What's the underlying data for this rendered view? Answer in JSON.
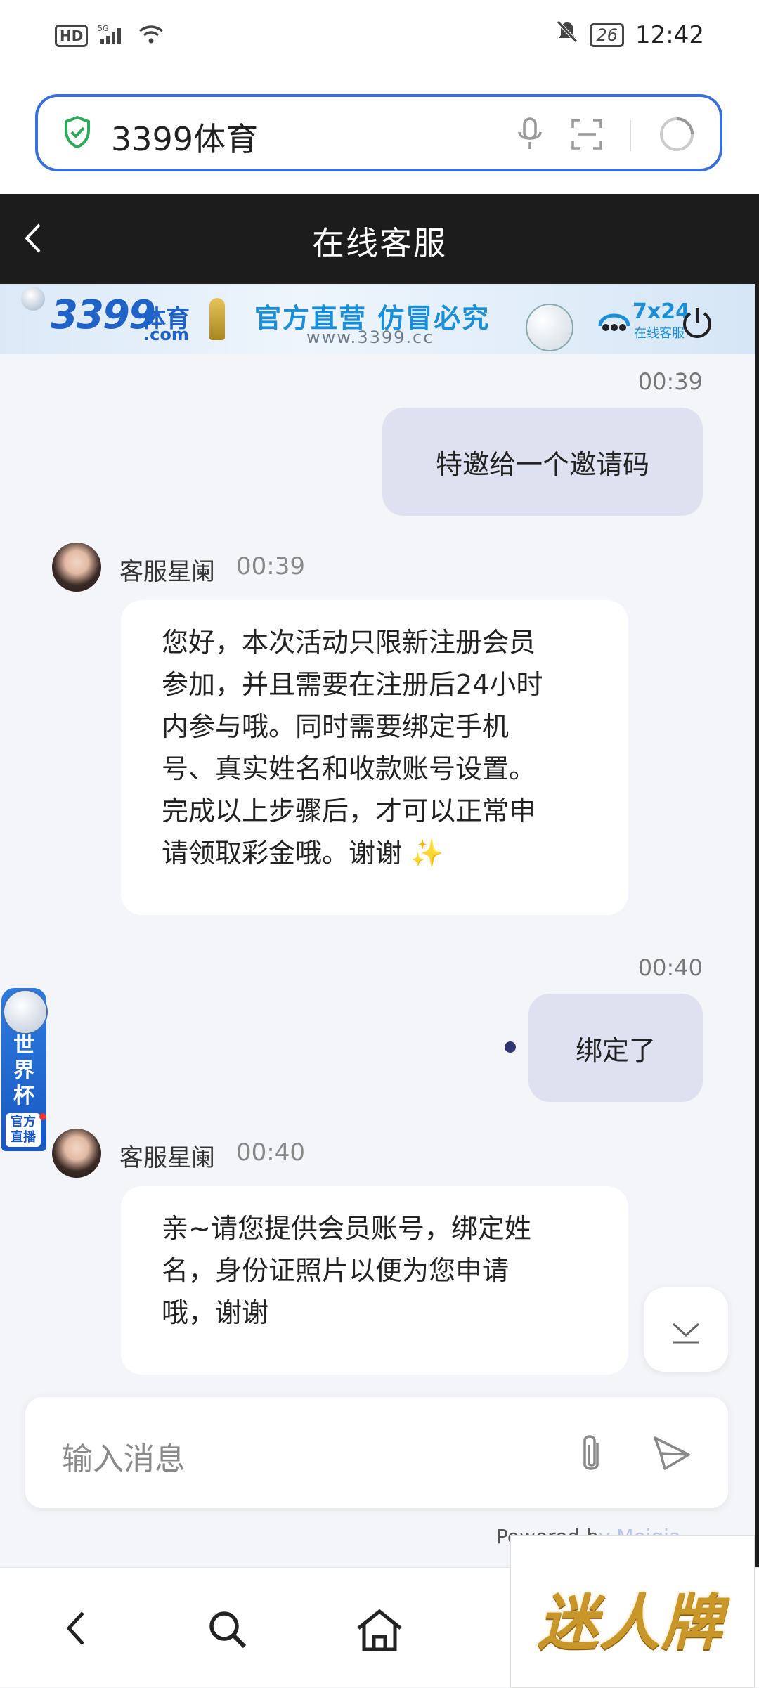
{
  "status_bar": {
    "hd": "HD",
    "signal": "5G",
    "battery": "26",
    "time": "12:42"
  },
  "address_bar": {
    "text": "3399体育"
  },
  "header": {
    "title": "在线客服"
  },
  "banner": {
    "brand": "3399",
    "brand_sub": "体育",
    "brand_com": ".com",
    "slogan": "官方直营  仿冒必究",
    "url": "www.3399.cc",
    "service": "7x24",
    "service_sub": "在线客服"
  },
  "messages": [
    {
      "from": "me",
      "time": "00:39",
      "text": "特邀给一个邀请码"
    },
    {
      "from": "agent",
      "name": "客服星阑",
      "time": "00:39",
      "lines": [
        "您好，本次活动只限新注册会员",
        "参加，并且需要在注册后24小时",
        "内参与哦。同时需要绑定手机",
        "号、真实姓名和收款账号设置。",
        "完成以上步骤后，才可以正常申",
        "请领取彩金哦。谢谢 ✨"
      ]
    },
    {
      "from": "me",
      "time": "00:40",
      "text": "绑定了"
    },
    {
      "from": "agent",
      "name": "客服星阑",
      "time": "00:40",
      "lines": [
        "亲~请您提供会员账号，绑定姓",
        "名，身份证照片以便为您申请",
        "哦，谢谢"
      ]
    }
  ],
  "worldcup_badge": {
    "text": "世界杯",
    "foot": "官方直播"
  },
  "input": {
    "placeholder": "输入消息"
  },
  "powered_by": {
    "visible": "Powered b",
    "faded": "y Meiqia"
  },
  "watermark": {
    "text": "迷人牌"
  },
  "colors": {
    "accent": "#3b6fd8",
    "header_bg": "#1c1c1c",
    "my_bubble": "#dfe1f1",
    "agent_bubble": "#ffffff"
  }
}
